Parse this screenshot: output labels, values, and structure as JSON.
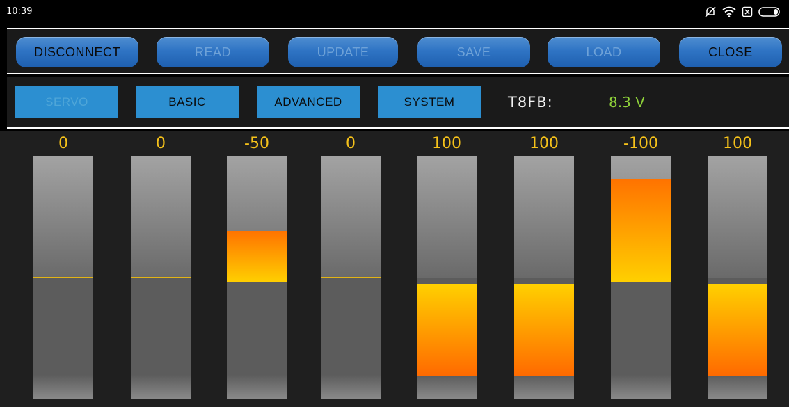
{
  "status_bar": {
    "time": "10:39",
    "icons": [
      "bell-muted-icon",
      "wifi-icon",
      "sim-x-icon",
      "battery-icon"
    ]
  },
  "toolbar": {
    "buttons": [
      {
        "label": "DISCONNECT",
        "enabled": true
      },
      {
        "label": "READ",
        "enabled": false
      },
      {
        "label": "UPDATE",
        "enabled": false
      },
      {
        "label": "SAVE",
        "enabled": false
      },
      {
        "label": "LOAD",
        "enabled": false
      },
      {
        "label": "CLOSE",
        "enabled": true
      }
    ]
  },
  "tabs": {
    "items": [
      {
        "label": "SERVO",
        "active": true
      },
      {
        "label": "BASIC",
        "active": false
      },
      {
        "label": "ADVANCED",
        "active": false
      },
      {
        "label": "SYSTEM",
        "active": false
      }
    ],
    "device": "T8FB:",
    "voltage": "8.3 V"
  },
  "channels": {
    "values": [
      "0",
      "0",
      "-50",
      "0",
      "100",
      "100",
      "-100",
      "100"
    ],
    "levels": [
      0,
      0,
      -50,
      0,
      100,
      100,
      -100,
      100
    ]
  },
  "colors": {
    "accent_button": "#2f74c4",
    "tab": "#2c8fd1",
    "value_text": "#f6c21a",
    "voltage_text": "#8fd23a",
    "fill_orange": "#ff7300",
    "fill_yellow": "#ffd000"
  }
}
